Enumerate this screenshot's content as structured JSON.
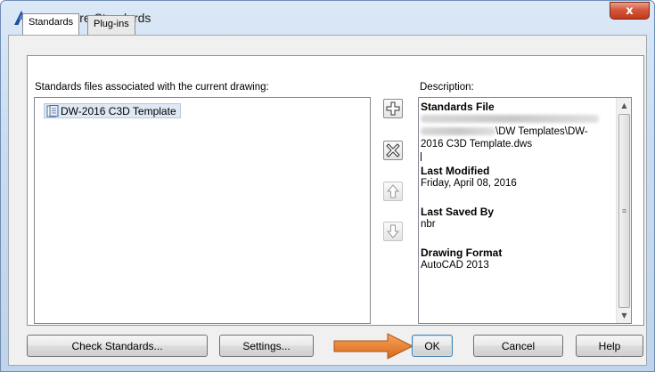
{
  "window": {
    "title": "Configure Standards",
    "close_label": "x"
  },
  "tabs": [
    {
      "label": "Standards",
      "active": true
    },
    {
      "label": "Plug-ins",
      "active": false
    }
  ],
  "standards_list": {
    "label": "Standards files associated with the current drawing:",
    "items": [
      "DW-2016 C3D Template"
    ]
  },
  "side_buttons": [
    {
      "icon": "plus-icon",
      "enabled": true
    },
    {
      "icon": "remove-x-icon",
      "enabled": true
    },
    {
      "icon": "move-up-arrow-icon",
      "enabled": false
    },
    {
      "icon": "move-down-arrow-icon",
      "enabled": false
    }
  ],
  "description": {
    "label": "Description:",
    "standards_file_heading": "Standards File",
    "standards_file_path_tail": "\\DW Templates\\DW-",
    "standards_file_path_end": "2016 C3D Template.dws",
    "last_modified_heading": "Last Modified",
    "last_modified_value": "Friday, April 08, 2016",
    "last_saved_by_heading": "Last Saved By",
    "last_saved_by_value": "nbr",
    "drawing_format_heading": "Drawing Format",
    "drawing_format_value": "AutoCAD 2013"
  },
  "buttons": {
    "check_standards": "Check Standards...",
    "settings": "Settings...",
    "ok": "OK",
    "cancel": "Cancel",
    "help": "Help"
  },
  "colors": {
    "annotation_arrow": "#e07b22",
    "app_icon": "#1a4f9c"
  }
}
